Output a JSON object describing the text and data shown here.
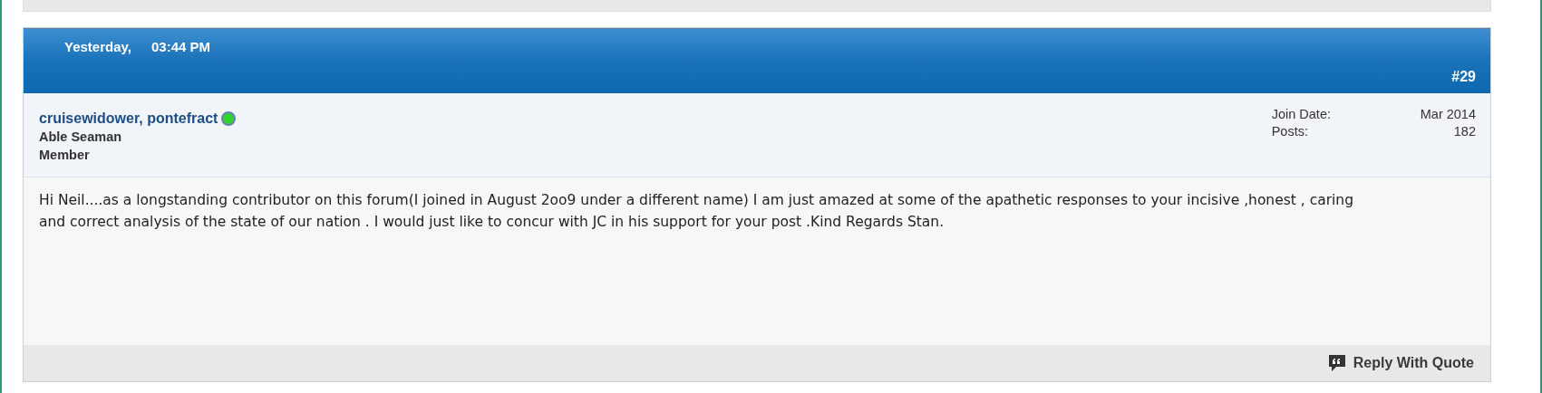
{
  "post": {
    "date": "Yesterday,",
    "time": "03:44 PM",
    "number": "#29",
    "user": {
      "name": "cruisewidower, pontefract",
      "online": true,
      "rank": "Able Seaman",
      "title": "Member"
    },
    "stats": [
      {
        "label": "Join Date:",
        "value": "Mar 2014"
      },
      {
        "label": "Posts:",
        "value": "182"
      }
    ],
    "message": "Hi Neil....as a longstanding contributor on this forum(I joined in August 2oo9 under a different name) I am just amazed at some of the apathetic responses to your incisive ,honest , caring and correct analysis of the state of our nation . I would just like to concur with JC in his support for your post .Kind Regards Stan.",
    "reply_button": "Reply With Quote"
  }
}
